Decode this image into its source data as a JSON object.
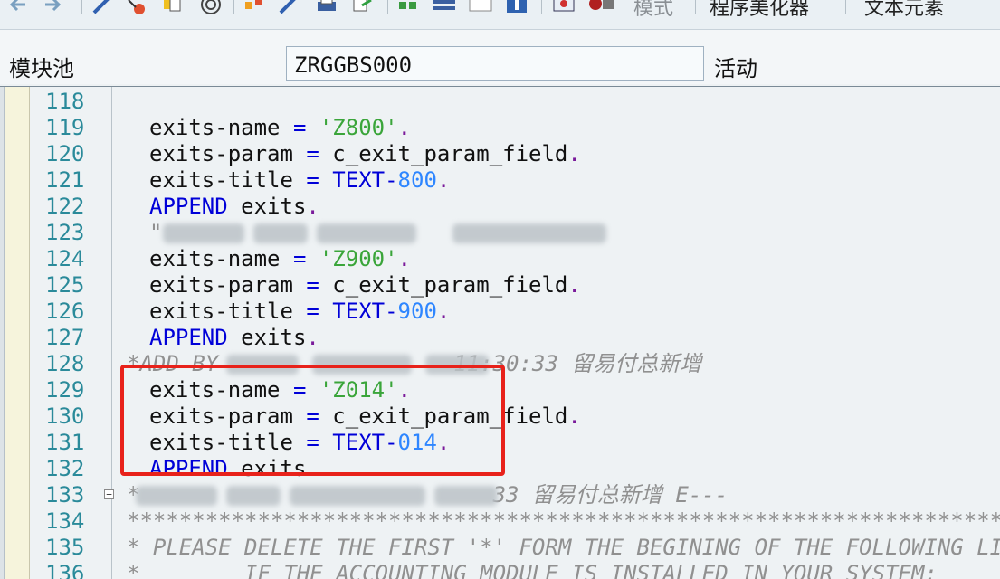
{
  "toolbar": {
    "icons": [
      "back-arrow-icon",
      "forward-arrow-icon",
      "pen-icon",
      "component-icon",
      "copy-icon",
      "target-icon",
      "hierarchy-icon",
      "edit-icon",
      "print-icon",
      "export-icon",
      "tree-icon",
      "stack-icon",
      "document-icon",
      "info-icon",
      "monitor-icon",
      "settings-icon"
    ],
    "pattern_label": "模式",
    "pretty_printer_label": "程序美化器",
    "text_elements_label": "文本元素"
  },
  "attributes": {
    "module_pool_label": "模块池",
    "module_pool_value": "ZRGGBS000",
    "status_label": "活动"
  },
  "editor": {
    "lines": [
      {
        "no": "118",
        "tokens": []
      },
      {
        "no": "119",
        "tokens": [
          {
            "t": "exits-name ",
            "c": "pl"
          },
          {
            "t": "= ",
            "c": "kw"
          },
          {
            "t": "'Z800'",
            "c": "str"
          },
          {
            "t": ".",
            "c": "dot"
          }
        ]
      },
      {
        "no": "120",
        "tokens": [
          {
            "t": "exits-param ",
            "c": "pl"
          },
          {
            "t": "= ",
            "c": "kw"
          },
          {
            "t": "c_exit_param_field",
            "c": "pl"
          },
          {
            "t": ".",
            "c": "dot"
          }
        ]
      },
      {
        "no": "121",
        "tokens": [
          {
            "t": "exits-title ",
            "c": "pl"
          },
          {
            "t": "= ",
            "c": "kw"
          },
          {
            "t": "TEXT-",
            "c": "kw"
          },
          {
            "t": "800",
            "c": "num"
          },
          {
            "t": ".",
            "c": "dot"
          }
        ]
      },
      {
        "no": "122",
        "tokens": [
          {
            "t": "APPEND ",
            "c": "kw"
          },
          {
            "t": "exits",
            "c": "pl"
          },
          {
            "t": ".",
            "c": "dot"
          }
        ]
      },
      {
        "no": "123",
        "tokens": [
          {
            "t": "\"",
            "c": "cm"
          }
        ]
      },
      {
        "no": "124",
        "tokens": [
          {
            "t": "exits-name ",
            "c": "pl"
          },
          {
            "t": "= ",
            "c": "kw"
          },
          {
            "t": "'Z900'",
            "c": "str"
          },
          {
            "t": ".",
            "c": "dot"
          }
        ]
      },
      {
        "no": "125",
        "tokens": [
          {
            "t": "exits-param ",
            "c": "pl"
          },
          {
            "t": "= ",
            "c": "kw"
          },
          {
            "t": "c_exit_param_field",
            "c": "pl"
          },
          {
            "t": ".",
            "c": "dot"
          }
        ]
      },
      {
        "no": "126",
        "tokens": [
          {
            "t": "exits-title ",
            "c": "pl"
          },
          {
            "t": "= ",
            "c": "kw"
          },
          {
            "t": "TEXT-",
            "c": "kw"
          },
          {
            "t": "900",
            "c": "num"
          },
          {
            "t": ".",
            "c": "dot"
          }
        ]
      },
      {
        "no": "127",
        "tokens": [
          {
            "t": "APPEND ",
            "c": "kw"
          },
          {
            "t": "exits",
            "c": "pl"
          },
          {
            "t": ".",
            "c": "dot"
          }
        ]
      },
      {
        "no": "128",
        "tokens": [
          {
            "t": "*ADD BY ",
            "c": "cm"
          },
          {
            "t": "                 11:30:33 留易付总新增",
            "c": "cm"
          }
        ]
      },
      {
        "no": "129",
        "tokens": [
          {
            "t": "exits-name ",
            "c": "pl"
          },
          {
            "t": "= ",
            "c": "kw"
          },
          {
            "t": "'Z014'",
            "c": "str"
          },
          {
            "t": ".",
            "c": "dot"
          }
        ]
      },
      {
        "no": "130",
        "tokens": [
          {
            "t": "exits-param ",
            "c": "pl"
          },
          {
            "t": "= ",
            "c": "kw"
          },
          {
            "t": "c_exit_param_field",
            "c": "pl"
          },
          {
            "t": ".",
            "c": "dot"
          }
        ]
      },
      {
        "no": "131",
        "tokens": [
          {
            "t": "exits-title ",
            "c": "pl"
          },
          {
            "t": "= ",
            "c": "kw"
          },
          {
            "t": "TEXT-",
            "c": "kw"
          },
          {
            "t": "014",
            "c": "num"
          },
          {
            "t": ".",
            "c": "dot"
          }
        ]
      },
      {
        "no": "132",
        "tokens": [
          {
            "t": "APPEND ",
            "c": "kw"
          },
          {
            "t": "exits",
            "c": "pl"
          },
          {
            "t": ".",
            "c": "dot"
          }
        ]
      },
      {
        "no": "133",
        "tokens": [
          {
            "t": "*",
            "c": "cm"
          },
          {
            "t": "                           33 留易付总新增 E---",
            "c": "cm"
          }
        ]
      },
      {
        "no": "134",
        "tokens": [
          {
            "t": "***************************************************************************",
            "c": "cm"
          }
        ]
      },
      {
        "no": "135",
        "tokens": [
          {
            "t": "* PLEASE DELETE THE FIRST '*' FORM THE BEGINING OF THE FOLLOWING LINES",
            "c": "cm"
          }
        ]
      },
      {
        "no": "136",
        "tokens": [
          {
            "t": "*        IF THE ACCOUNTING MODULE IS INSTALLED IN YOUR SYSTEM:",
            "c": "cm"
          }
        ]
      }
    ]
  }
}
